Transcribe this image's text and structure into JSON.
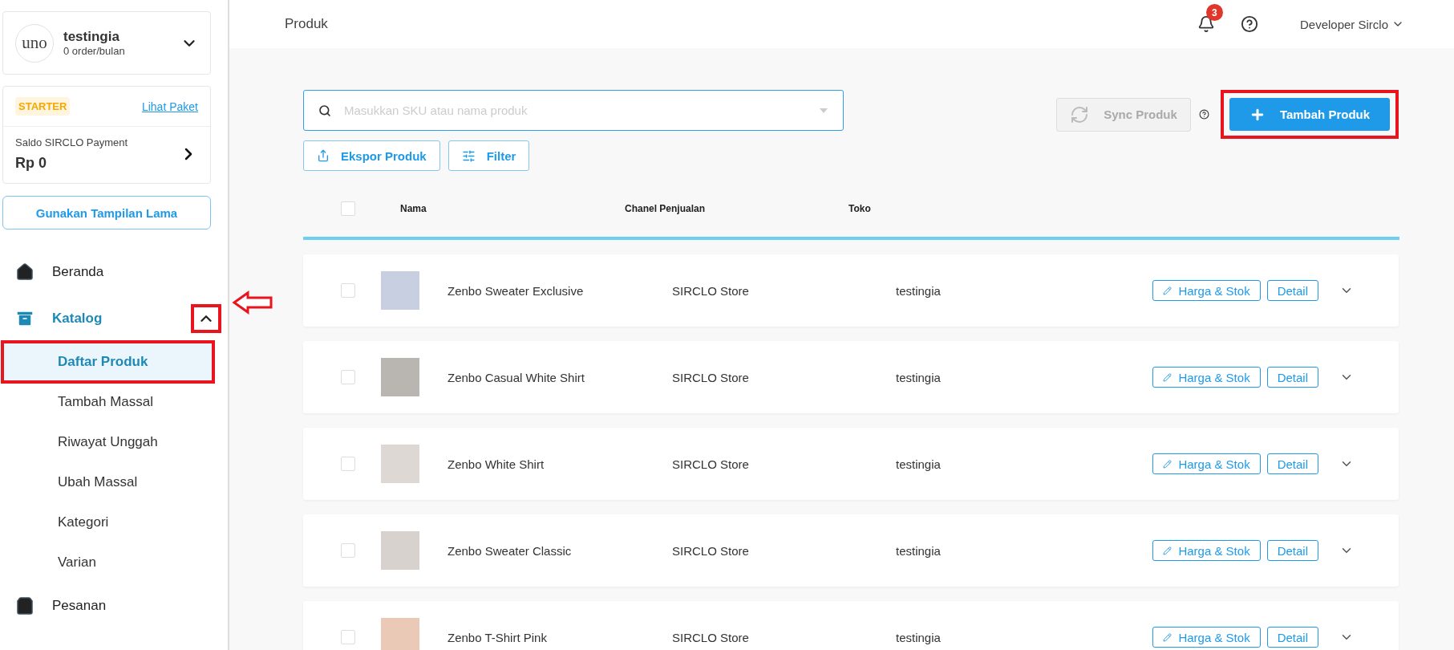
{
  "store": {
    "logo": "uno",
    "name": "testingia",
    "subtitle": "0 order/bulan"
  },
  "plan": {
    "badge": "STARTER",
    "link": "Lihat Paket",
    "balance_label": "Saldo SIRCLO Payment",
    "balance": "Rp 0"
  },
  "legacy_button": "Gunakan Tampilan Lama",
  "nav": [
    {
      "label": "Beranda",
      "kind": "home",
      "selected": false
    },
    {
      "label": "Katalog",
      "kind": "box",
      "selected": true,
      "expanded": true,
      "annotated": true,
      "children": [
        {
          "label": "Daftar Produk",
          "selected": true,
          "annotated": true
        },
        {
          "label": "Tambah Massal",
          "selected": false,
          "annotated": false
        },
        {
          "label": "Riwayat Unggah",
          "selected": false,
          "annotated": false
        },
        {
          "label": "Ubah Massal",
          "selected": false,
          "annotated": false
        },
        {
          "label": "Kategori",
          "selected": false,
          "annotated": false
        },
        {
          "label": "Varian",
          "selected": false,
          "annotated": false
        }
      ]
    },
    {
      "label": "Pesanan",
      "kind": "bag",
      "selected": false
    }
  ],
  "topbar": {
    "title": "Produk",
    "notifications": "3",
    "user": "Developer Sirclo"
  },
  "search": {
    "placeholder": "Masukkan SKU atau nama produk"
  },
  "actions": [
    {
      "label": "Ekspor Produk",
      "kind": "export"
    },
    {
      "label": "Filter",
      "kind": "filter"
    }
  ],
  "sync_button": {
    "label": "Sync Produk",
    "disabled": true
  },
  "add_button": {
    "label": "Tambah Produk",
    "annotated": true
  },
  "table": {
    "select_all": false,
    "columns": [
      "Nama",
      "Chanel Penjualan",
      "Toko"
    ],
    "rows": [
      {
        "name": "Zenbo Sweater Exclusive",
        "channel": "SIRCLO Store",
        "store": "testingia",
        "checked": false,
        "price_button": "Harga & Stok",
        "detail_button": "Detail"
      },
      {
        "name": "Zenbo Casual White Shirt",
        "channel": "SIRCLO Store",
        "store": "testingia",
        "checked": false,
        "price_button": "Harga & Stok",
        "detail_button": "Detail"
      },
      {
        "name": "Zenbo White Shirt",
        "channel": "SIRCLO Store",
        "store": "testingia",
        "checked": false,
        "price_button": "Harga & Stok",
        "detail_button": "Detail"
      },
      {
        "name": "Zenbo Sweater Classic",
        "channel": "SIRCLO Store",
        "store": "testingia",
        "checked": false,
        "price_button": "Harga & Stok",
        "detail_button": "Detail"
      },
      {
        "name": "Zenbo T-Shirt Pink",
        "channel": "SIRCLO Store",
        "store": "testingia",
        "checked": false,
        "price_button": "Harga & Stok",
        "detail_button": "Detail"
      }
    ]
  }
}
